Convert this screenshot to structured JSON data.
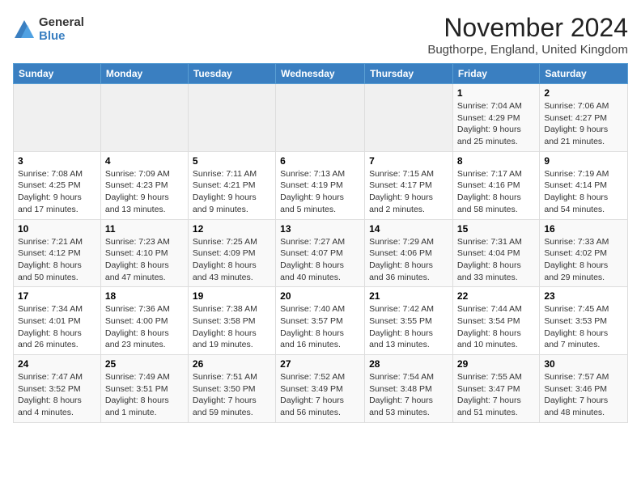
{
  "logo": {
    "general": "General",
    "blue": "Blue"
  },
  "title": "November 2024",
  "subtitle": "Bugthorpe, England, United Kingdom",
  "days_header": [
    "Sunday",
    "Monday",
    "Tuesday",
    "Wednesday",
    "Thursday",
    "Friday",
    "Saturday"
  ],
  "weeks": [
    [
      {
        "day": "",
        "info": ""
      },
      {
        "day": "",
        "info": ""
      },
      {
        "day": "",
        "info": ""
      },
      {
        "day": "",
        "info": ""
      },
      {
        "day": "",
        "info": ""
      },
      {
        "day": "1",
        "info": "Sunrise: 7:04 AM\nSunset: 4:29 PM\nDaylight: 9 hours and 25 minutes."
      },
      {
        "day": "2",
        "info": "Sunrise: 7:06 AM\nSunset: 4:27 PM\nDaylight: 9 hours and 21 minutes."
      }
    ],
    [
      {
        "day": "3",
        "info": "Sunrise: 7:08 AM\nSunset: 4:25 PM\nDaylight: 9 hours and 17 minutes."
      },
      {
        "day": "4",
        "info": "Sunrise: 7:09 AM\nSunset: 4:23 PM\nDaylight: 9 hours and 13 minutes."
      },
      {
        "day": "5",
        "info": "Sunrise: 7:11 AM\nSunset: 4:21 PM\nDaylight: 9 hours and 9 minutes."
      },
      {
        "day": "6",
        "info": "Sunrise: 7:13 AM\nSunset: 4:19 PM\nDaylight: 9 hours and 5 minutes."
      },
      {
        "day": "7",
        "info": "Sunrise: 7:15 AM\nSunset: 4:17 PM\nDaylight: 9 hours and 2 minutes."
      },
      {
        "day": "8",
        "info": "Sunrise: 7:17 AM\nSunset: 4:16 PM\nDaylight: 8 hours and 58 minutes."
      },
      {
        "day": "9",
        "info": "Sunrise: 7:19 AM\nSunset: 4:14 PM\nDaylight: 8 hours and 54 minutes."
      }
    ],
    [
      {
        "day": "10",
        "info": "Sunrise: 7:21 AM\nSunset: 4:12 PM\nDaylight: 8 hours and 50 minutes."
      },
      {
        "day": "11",
        "info": "Sunrise: 7:23 AM\nSunset: 4:10 PM\nDaylight: 8 hours and 47 minutes."
      },
      {
        "day": "12",
        "info": "Sunrise: 7:25 AM\nSunset: 4:09 PM\nDaylight: 8 hours and 43 minutes."
      },
      {
        "day": "13",
        "info": "Sunrise: 7:27 AM\nSunset: 4:07 PM\nDaylight: 8 hours and 40 minutes."
      },
      {
        "day": "14",
        "info": "Sunrise: 7:29 AM\nSunset: 4:06 PM\nDaylight: 8 hours and 36 minutes."
      },
      {
        "day": "15",
        "info": "Sunrise: 7:31 AM\nSunset: 4:04 PM\nDaylight: 8 hours and 33 minutes."
      },
      {
        "day": "16",
        "info": "Sunrise: 7:33 AM\nSunset: 4:02 PM\nDaylight: 8 hours and 29 minutes."
      }
    ],
    [
      {
        "day": "17",
        "info": "Sunrise: 7:34 AM\nSunset: 4:01 PM\nDaylight: 8 hours and 26 minutes."
      },
      {
        "day": "18",
        "info": "Sunrise: 7:36 AM\nSunset: 4:00 PM\nDaylight: 8 hours and 23 minutes."
      },
      {
        "day": "19",
        "info": "Sunrise: 7:38 AM\nSunset: 3:58 PM\nDaylight: 8 hours and 19 minutes."
      },
      {
        "day": "20",
        "info": "Sunrise: 7:40 AM\nSunset: 3:57 PM\nDaylight: 8 hours and 16 minutes."
      },
      {
        "day": "21",
        "info": "Sunrise: 7:42 AM\nSunset: 3:55 PM\nDaylight: 8 hours and 13 minutes."
      },
      {
        "day": "22",
        "info": "Sunrise: 7:44 AM\nSunset: 3:54 PM\nDaylight: 8 hours and 10 minutes."
      },
      {
        "day": "23",
        "info": "Sunrise: 7:45 AM\nSunset: 3:53 PM\nDaylight: 8 hours and 7 minutes."
      }
    ],
    [
      {
        "day": "24",
        "info": "Sunrise: 7:47 AM\nSunset: 3:52 PM\nDaylight: 8 hours and 4 minutes."
      },
      {
        "day": "25",
        "info": "Sunrise: 7:49 AM\nSunset: 3:51 PM\nDaylight: 8 hours and 1 minute."
      },
      {
        "day": "26",
        "info": "Sunrise: 7:51 AM\nSunset: 3:50 PM\nDaylight: 7 hours and 59 minutes."
      },
      {
        "day": "27",
        "info": "Sunrise: 7:52 AM\nSunset: 3:49 PM\nDaylight: 7 hours and 56 minutes."
      },
      {
        "day": "28",
        "info": "Sunrise: 7:54 AM\nSunset: 3:48 PM\nDaylight: 7 hours and 53 minutes."
      },
      {
        "day": "29",
        "info": "Sunrise: 7:55 AM\nSunset: 3:47 PM\nDaylight: 7 hours and 51 minutes."
      },
      {
        "day": "30",
        "info": "Sunrise: 7:57 AM\nSunset: 3:46 PM\nDaylight: 7 hours and 48 minutes."
      }
    ]
  ]
}
